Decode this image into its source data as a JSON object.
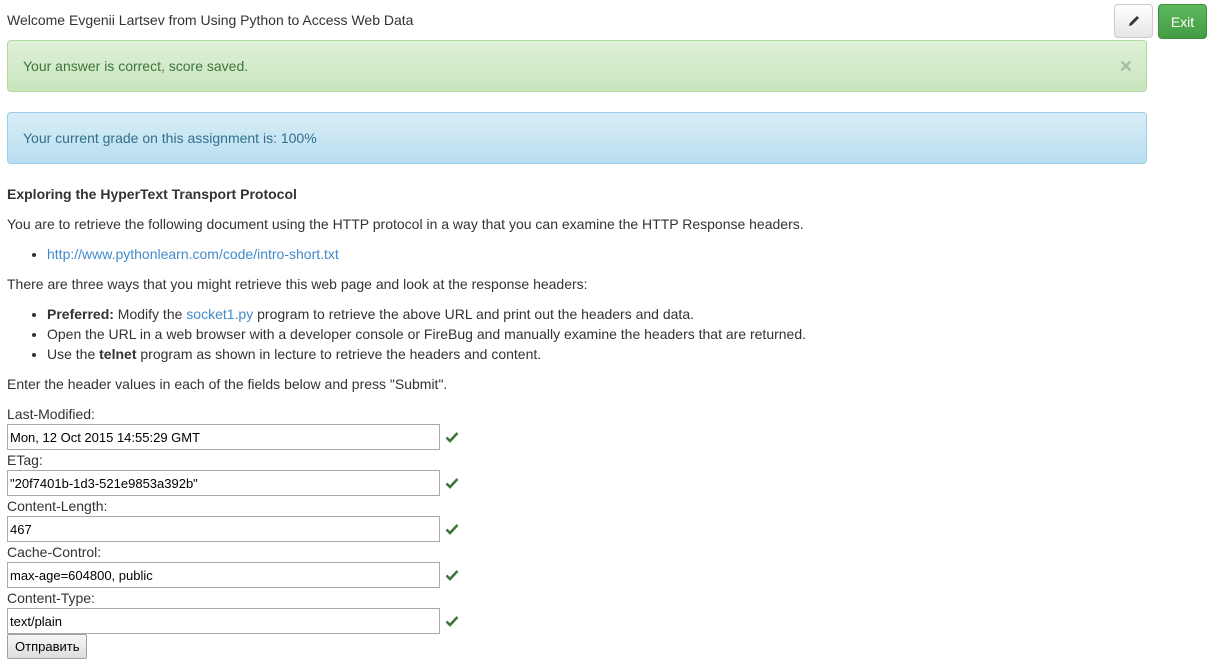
{
  "header": {
    "welcome": "Welcome Evgenii Lartsev from Using Python to Access Web Data",
    "edit_icon": "pencil-icon",
    "exit_label": "Exit"
  },
  "alerts": {
    "success": "Your answer is correct, score saved.",
    "close_glyph": "×",
    "info": "Your current grade on this assignment is: 100%"
  },
  "content": {
    "title": "Exploring the HyperText Transport Protocol",
    "intro": "You are to retrieve the following document using the HTTP protocol in a way that you can examine the HTTP Response headers.",
    "url": "http://www.pythonlearn.com/code/intro-short.txt",
    "ways_intro": "There are three ways that you might retrieve this web page and look at the response headers:",
    "way1_bold": "Preferred:",
    "way1_pre": " Modify the ",
    "way1_link": "socket1.py",
    "way1_post": " program to retrieve the above URL and print out the headers and data.",
    "way2": "Open the URL in a web browser with a developer console or FireBug and manually examine the headers that are returned.",
    "way3_pre": "Use the ",
    "way3_bold": "telnet",
    "way3_post": " program as shown in lecture to retrieve the headers and content.",
    "instructions": "Enter the header values in each of the fields below and press \"Submit\"."
  },
  "form": {
    "fields": [
      {
        "label": "Last-Modified:",
        "value": "Mon, 12 Oct 2015 14:55:29 GMT"
      },
      {
        "label": "ETag:",
        "value": "\"20f7401b-1d3-521e9853a392b\""
      },
      {
        "label": "Content-Length:",
        "value": "467"
      },
      {
        "label": "Cache-Control:",
        "value": "max-age=604800, public"
      },
      {
        "label": "Content-Type:",
        "value": "text/plain"
      }
    ],
    "check_icon": "checkmark-icon",
    "check_color": "#3c763d",
    "submit_label": "Отправить"
  },
  "colors": {
    "success_bg": "#dff0d8",
    "info_bg": "#d9edf7",
    "exit_button": "#5cb85c",
    "link": "#428bca"
  }
}
